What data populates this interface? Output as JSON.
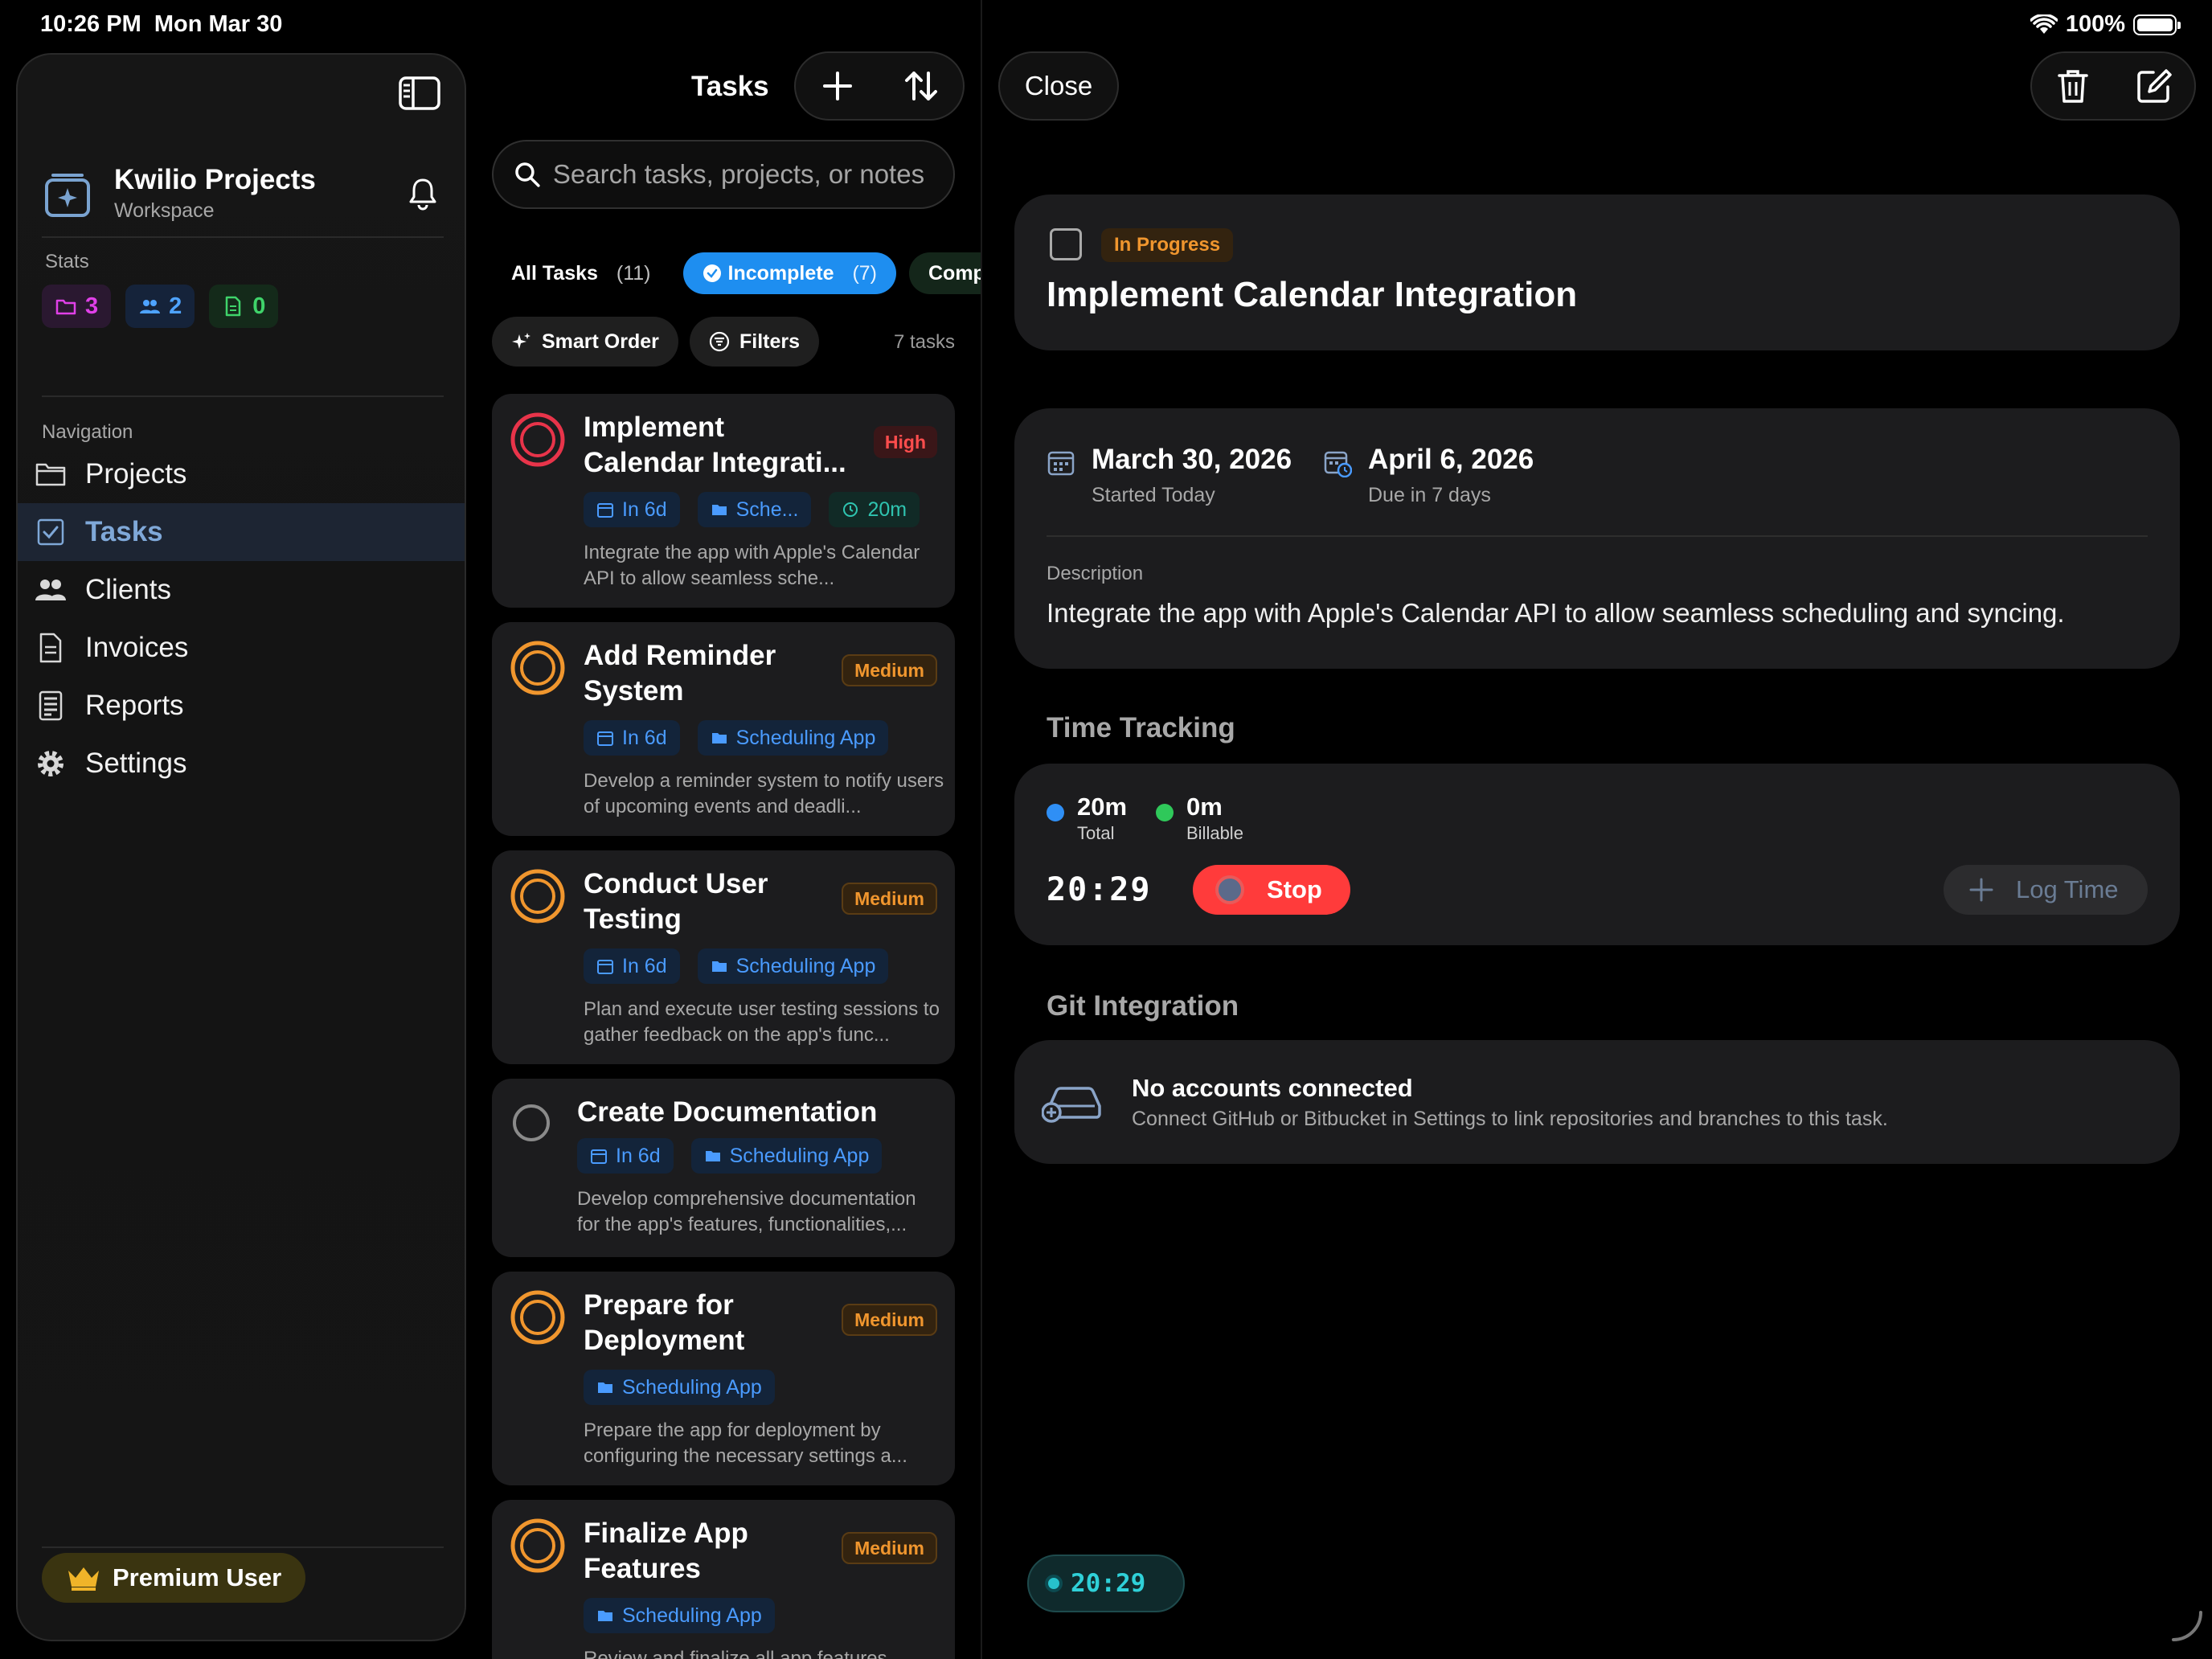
{
  "status_bar": {
    "time": "10:26 PM",
    "date": "Mon Mar 30",
    "battery": "100%"
  },
  "sidebar": {
    "workspace_title": "Kwilio Projects",
    "workspace_subtitle": "Workspace",
    "stats_label": "Stats",
    "stats": {
      "projects": "3",
      "clients": "2",
      "invoices": "0"
    },
    "nav_label": "Navigation",
    "nav_items": [
      {
        "label": "Projects",
        "icon": "folder-icon"
      },
      {
        "label": "Tasks",
        "icon": "checkbox-icon",
        "active": true
      },
      {
        "label": "Clients",
        "icon": "people-icon"
      },
      {
        "label": "Invoices",
        "icon": "document-icon"
      },
      {
        "label": "Reports",
        "icon": "report-icon"
      },
      {
        "label": "Settings",
        "icon": "gear-icon"
      }
    ],
    "premium_label": "Premium User"
  },
  "list": {
    "title": "Tasks",
    "search_placeholder": "Search tasks, projects, or notes",
    "filters": [
      {
        "label": "All Tasks",
        "count": "(11)"
      },
      {
        "label": "Incomplete",
        "count": "(7)",
        "active": true
      },
      {
        "label": "Comple",
        "count": ""
      }
    ],
    "smart_order": "Smart Order",
    "filters_label": "Filters",
    "task_count": "7 tasks",
    "tasks": [
      {
        "title": "Implement Calendar Integrati...",
        "priority": "High",
        "due": "In 6d",
        "project": "Sche...",
        "time": "20m",
        "desc": "Integrate the app with Apple's Calendar API to allow seamless sche..."
      },
      {
        "title": "Add Reminder System",
        "priority": "Medium",
        "due": "In 6d",
        "project": "Scheduling App",
        "desc": "Develop a reminder system to notify users of upcoming events and deadli..."
      },
      {
        "title": "Conduct User Testing",
        "priority": "Medium",
        "due": "In 6d",
        "project": "Scheduling App",
        "desc": "Plan and execute user testing sessions to gather feedback on the app's func..."
      },
      {
        "title": "Create Documentation",
        "due": "In 6d",
        "project": "Scheduling App",
        "desc": "Develop comprehensive documentation for the app's features, functionalities,..."
      },
      {
        "title": "Prepare for Deployment",
        "priority": "Medium",
        "project": "Scheduling App",
        "desc": "Prepare the app for deployment by configuring the necessary settings a..."
      },
      {
        "title": "Finalize App Features",
        "priority": "Medium",
        "project": "Scheduling App",
        "desc": "Review and finalize all app features"
      }
    ]
  },
  "detail": {
    "close_label": "Close",
    "status": "In Progress",
    "title": "Implement Calendar Integration",
    "start_date": "March 30, 2026",
    "start_sub": "Started Today",
    "due_date": "April 6, 2026",
    "due_sub": "Due in 7 days",
    "description_label": "Description",
    "description": "Integrate the app with Apple's Calendar API to allow seamless scheduling and syncing.",
    "time_tracking_title": "Time Tracking",
    "total_value": "20m",
    "total_label": "Total",
    "billable_value": "0m",
    "billable_label": "Billable",
    "timer": "20:29",
    "stop_label": "Stop",
    "log_time_label": "Log Time",
    "git_title": "Git Integration",
    "git_empty_title": "No accounts connected",
    "git_empty_sub": "Connect GitHub or Bitbucket in Settings to link repositories and branches to this task.",
    "floating_timer": "20:29"
  },
  "colors": {
    "accent_blue": "#1e8ef0",
    "high": "#ff4d4d",
    "medium": "#f0962e",
    "stop": "#ff3b3b",
    "timer_teal": "#2fd0d8"
  }
}
